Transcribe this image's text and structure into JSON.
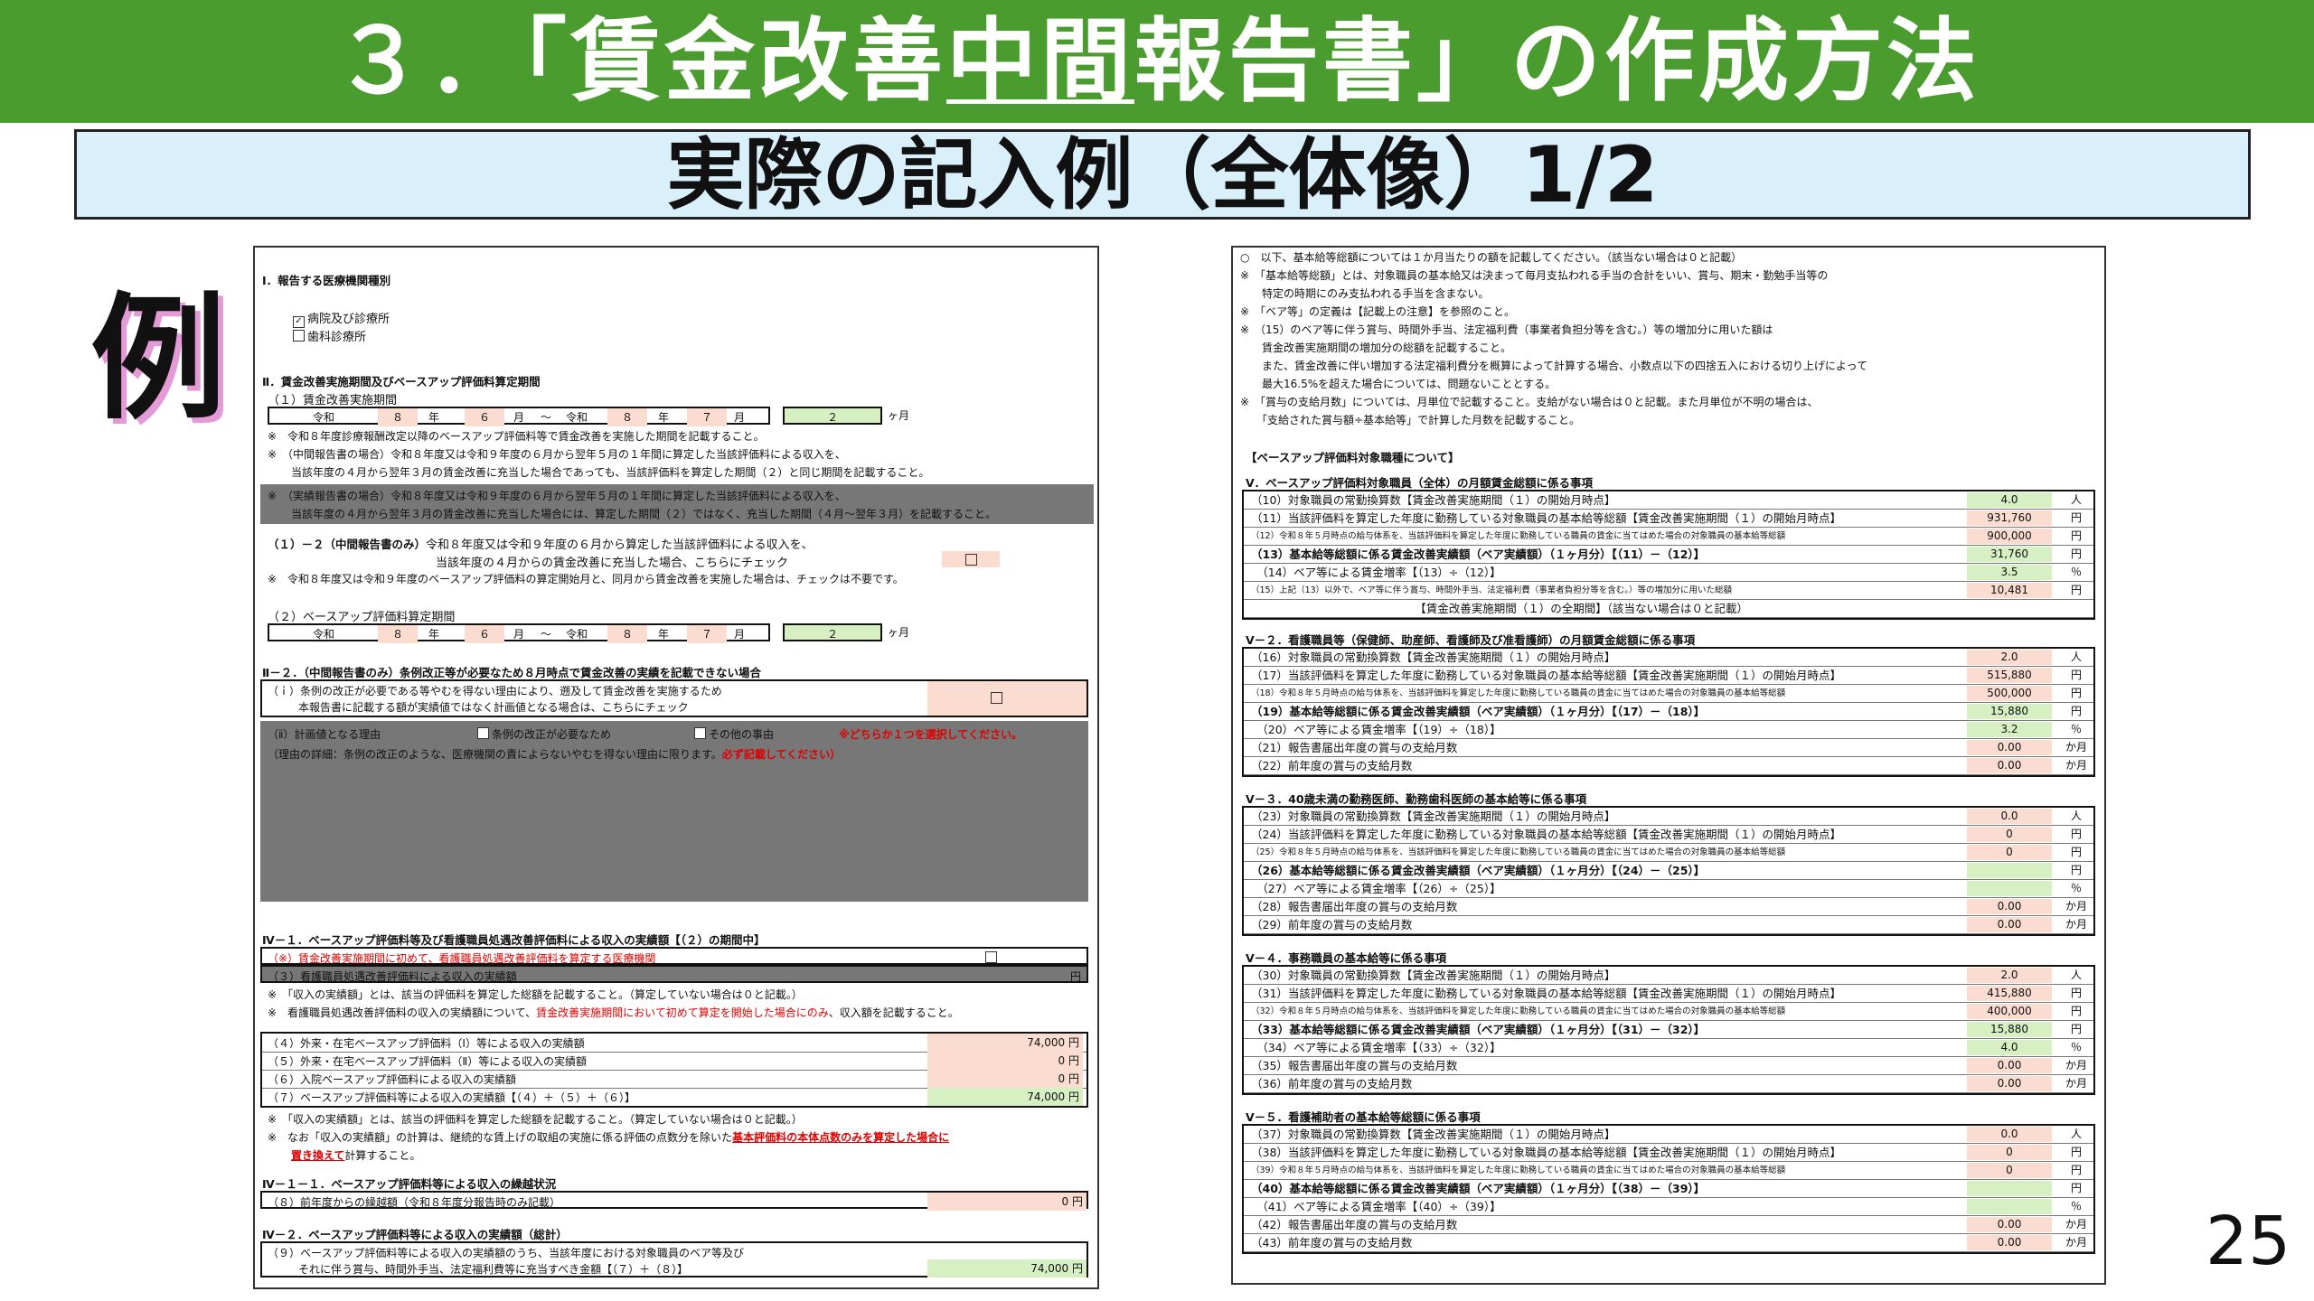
{
  "title": "３．「賃金改善中間報告書」の作成方法",
  "title_parts": [
    "３．「賃金改善",
    "中間",
    "報告書」の作成方法"
  ],
  "subtitle": "実際の記入例（全体像）1/2",
  "example_label": "例",
  "page_number": "25",
  "left": {
    "sec1_heading": "Ⅰ．報告する医療機関種別",
    "sec1_opt1": "病院及び診療所",
    "sec1_opt2": "歯科診療所",
    "sec2_heading": "Ⅱ．賃金改善実施期間及びベースアップ評価料算定期間",
    "sec2_sub1": "（１）賃金改善実施期間",
    "period1": [
      "令和",
      "８",
      "年",
      "６",
      "月",
      "～",
      "令和",
      "８",
      "年",
      "７",
      "月",
      "２",
      "ヶ月"
    ],
    "note_a": "※　令和８年度診療報酬改定以降のベースアップ評価料等で賃金改善を実施した期間を記載すること。",
    "note_b": "※　（中間報告書の場合）令和８年度又は令和９年度の６月から翌年５月の１年間に算定した当該評価料による収入を、",
    "note_b2": "当該年度の４月から翌年３月の賃金改善に充当した場合であっても、当該評価料を算定した期間（２）と同じ期間を記載すること。",
    "note_gray1": "※　（実績報告書の場合）令和８年度又は令和９年度の６月から翌年５月の１年間に算定した当該評価料による収入を、",
    "note_gray2": "当該年度の４月から翌年３月の賃金改善に充当した場合には、算定した期間（２）ではなく、充当した期間（４月～翌年３月）を記載すること。",
    "s12_label": "（１）－２（中間報告書のみ）",
    "s12_text": "令和８年度又は令和９年度の６月から算定した当該評価料による収入を、",
    "s12_text2": "当該年度の４月からの賃金改善に充当した場合、こちらにチェック",
    "s12_note": "※　令和８年度又は令和９年度のベースアップ評価料の算定開始月と、同月から賃金改善を実施した場合は、チェックは不要です。",
    "sec2_sub2": "（２）ベースアップ評価料算定期間",
    "period2": [
      "令和",
      "８",
      "年",
      "６",
      "月",
      "～",
      "令和",
      "８",
      "年",
      "７",
      "月",
      "２",
      "ヶ月"
    ],
    "sec22_heading": "Ⅱ－２．（中間報告書のみ）条例改正等が必要なため８月時点で賃金改善の実績を記載できない場合",
    "sec22_i1": "（ｉ）条例の改正が必要である等やむを得ない理由により、遡及して賃金改善を実施するため",
    "sec22_i2": "本報告書に記載する額が実績値ではなく計画値となる場合は、こちらにチェック",
    "sec22_ii": "（ⅱ）計画値となる理由",
    "sec22_opt1": "条例の改正が必要なため",
    "sec22_opt2": "その他の事由",
    "sec22_red1": "※どちらか１つを選択してください。",
    "sec22_detail": "（理由の詳細：条例の改正のような、医療機関の責によらないやむを得ない理由に限ります。",
    "sec22_red2": "必ず記載してください）",
    "sec41_heading": "Ⅳ－１．ベースアップ評価料等及び看護職員処遇改善評価料による収入の実績額【（２）の期間中】",
    "r_row1": "（※）賃金改善実施期間に初めて、看護職員処遇改善評価料を算定する医療機関",
    "r_row2": "（３）看護職員処遇改善評価料による収入の実績額",
    "r_row2_unit": "円",
    "note_c": "※　「収入の実績額」とは、該当の評価料を算定した総額を記載すること。（算定していない場合は０と記載。）",
    "note_d": "※　看護職員処遇改善評価料の収入の実績額について、",
    "note_d_red": "賃金改善実施期間において初めて算定を開始した場合にのみ",
    "note_d2": "、収入額を記載すること。",
    "rows": [
      {
        "label": "（４）外来・在宅ベースアップ評価料（Ⅰ）等による収入の実績額",
        "value": "74,000 円"
      },
      {
        "label": "（５）外来・在宅ベースアップ評価料（Ⅱ）等による収入の実績額",
        "value": "0 円"
      },
      {
        "label": "（６）入院ベースアップ評価料による収入の実績額",
        "value": "0 円"
      },
      {
        "label": "（７）ベースアップ評価料等による収入の実績額【（４）＋（５）＋（６）】",
        "value": "74,000 円"
      }
    ],
    "note_e": "※　「収入の実績額」とは、該当の評価料を算定した総額を記載すること。（算定していない場合は０と記載。）",
    "note_f": "※　なお「収入の実績額」の計算は、継続的な賃上げの取組の実施に係る評価の点数分を除いた",
    "note_f_red": "基本評価料の本体点数のみを算定した場合に",
    "note_f2_red": "置き換えて",
    "note_f2": "計算すること。",
    "sec411_heading": "Ⅳ－１－１．ベースアップ評価料等による収入の繰越状況",
    "r8_label": "（８）前年度からの繰越額（令和８年度分報告時のみ記載）",
    "r8_value": "0 円",
    "sec42_heading": "Ⅳ－２．ベースアップ評価料等による収入の実績額（総計）",
    "r9_label1": "（９）ベースアップ評価料等による収入の実績額のうち、当該年度における対象職員のベア等及び",
    "r9_label2": "それに伴う賞与、時間外手当、法定福利費等に充当すべき金額【（７）＋（８）】",
    "r9_value": "74,000 円"
  },
  "right": {
    "intro": [
      "○　以下、基本給等総額については１か月当たりの額を記載してください。（該当ない場合は０と記載）",
      "※　「基本給等総額」とは、対象職員の基本給又は決まって毎月支払われる手当の合計をいい、賞与、期末・勤勉手当等の",
      "　　特定の時期にのみ支払われる手当を含まない。",
      "※　「ベア等」の定義は【記載上の注意】を参照のこと。",
      "※　（15）のベア等に伴う賞与、時間外手当、法定福利費（事業者負担分等を含む。）等の増加分に用いた額は",
      "　　賃金改善実施期間の増加分の総額を記載すること。",
      "　　また、賃金改善に伴い増加する法定福利費分を概算によって計算する場合、小数点以下の四捨五入における切り上げによって",
      "　　最大16.5%を超えた場合については、問題ないこととする。",
      "※　「賞与の支給月数」については、月単位で記載すること。支給がない場合は０と記載。また月単位が不明の場合は、",
      "　　「支給された賞与額÷基本給等」で計算した月数を記載すること。"
    ],
    "bracket_heading": "【ベースアップ評価料対象職種について】",
    "groups": [
      {
        "heading": "Ⅴ．ベースアップ評価料対象職員（全体）の月額賃金総額に係る事項",
        "rows": [
          {
            "label": "（10）対象職員の常勤換算数【賃金改善実施期間（１）の開始月時点】",
            "value": "4.0",
            "unit": "人",
            "cls": "greenc"
          },
          {
            "label": "（11）当該評価料を算定した年度に勤務している対象職員の基本給等総額【賃金改善実施期間（１）の開始月時点】",
            "value": "931,760",
            "unit": "円",
            "cls": "pinkc"
          },
          {
            "label": "（12）令和８年５月時点の給与体系を、当該評価料を算定した年度に勤務している職員の賃金に当てはめた場合の対象職員の基本給等総額",
            "value": "900,000",
            "unit": "円",
            "cls": "pinkc",
            "small": true
          },
          {
            "label": "（13）基本給等総額に係る賃金改善実績額（ベア実績額）（１ヶ月分）【（11）－（12）】",
            "value": "31,760",
            "unit": "円",
            "cls": "greenc",
            "bold": true
          },
          {
            "label": "　（14）ベア等による賃金増率【（13）÷（12）】",
            "value": "3.5",
            "unit": "％",
            "cls": "greenc"
          },
          {
            "label": "（15）上記（13）以外で、ベア等に伴う賞与、時間外手当、法定福利費（事業者負担分等を含む。）等の増加分に用いた総額",
            "value": "10,481",
            "unit": "円",
            "cls": "pinkc",
            "small": true
          },
          {
            "label": "　　　　　　　　　　　　　　　【賃金改善実施期間（１）の全期間】（該当ない場合は０と記載）",
            "value": "",
            "unit": "",
            "cls": ""
          }
        ]
      },
      {
        "heading": "Ⅴ－２．看護職員等（保健師、助産師、看護師及び准看護師）の月額賃金総額に係る事項",
        "rows": [
          {
            "label": "（16）対象職員の常勤換算数【賃金改善実施期間（１）の開始月時点】",
            "value": "2.0",
            "unit": "人",
            "cls": "pinkc"
          },
          {
            "label": "（17）当該評価料を算定した年度に勤務している対象職員の基本給等総額【賃金改善実施期間（１）の開始月時点】",
            "value": "515,880",
            "unit": "円",
            "cls": "pinkc"
          },
          {
            "label": "（18）令和８年５月時点の給与体系を、当該評価料を算定した年度に勤務している職員の賃金に当てはめた場合の対象職員の基本給等総額",
            "value": "500,000",
            "unit": "円",
            "cls": "pinkc",
            "small": true
          },
          {
            "label": "（19）基本給等総額に係る賃金改善実績額（ベア実績額）（１ヶ月分）【（17）－（18）】",
            "value": "15,880",
            "unit": "円",
            "cls": "greenc",
            "bold": true
          },
          {
            "label": "　（20）ベア等による賃金増率【（19）÷（18）】",
            "value": "3.2",
            "unit": "％",
            "cls": "greenc"
          },
          {
            "label": "（21）報告書届出年度の賞与の支給月数",
            "value": "0.00",
            "unit": "か月",
            "cls": "pinkc"
          },
          {
            "label": "（22）前年度の賞与の支給月数",
            "value": "0.00",
            "unit": "か月",
            "cls": "pinkc"
          }
        ]
      },
      {
        "heading": "Ⅴ－３．40歳未満の勤務医師、勤務歯科医師の基本給等に係る事項",
        "rows": [
          {
            "label": "（23）対象職員の常勤換算数【賃金改善実施期間（１）の開始月時点】",
            "value": "0.0",
            "unit": "人",
            "cls": "pinkc"
          },
          {
            "label": "（24）当該評価料を算定した年度に勤務している対象職員の基本給等総額【賃金改善実施期間（１）の開始月時点】",
            "value": "0",
            "unit": "円",
            "cls": "pinkc"
          },
          {
            "label": "（25）令和８年５月時点の給与体系を、当該評価料を算定した年度に勤務している職員の賃金に当てはめた場合の対象職員の基本給等総額",
            "value": "0",
            "unit": "円",
            "cls": "pinkc",
            "small": true
          },
          {
            "label": "（26）基本給等総額に係る賃金改善実績額（ベア実績額）（１ヶ月分）【（24）－（25）】",
            "value": "",
            "unit": "円",
            "cls": "greenc",
            "bold": true
          },
          {
            "label": "　（27）ベア等による賃金増率【（26）÷（25）】",
            "value": "",
            "unit": "％",
            "cls": "greenc"
          },
          {
            "label": "（28）報告書届出年度の賞与の支給月数",
            "value": "0.00",
            "unit": "か月",
            "cls": "pinkc"
          },
          {
            "label": "（29）前年度の賞与の支給月数",
            "value": "0.00",
            "unit": "か月",
            "cls": "pinkc"
          }
        ]
      },
      {
        "heading": "Ⅴ－４．事務職員の基本給等に係る事項",
        "rows": [
          {
            "label": "（30）対象職員の常勤換算数【賃金改善実施期間（１）の開始月時点】",
            "value": "2.0",
            "unit": "人",
            "cls": "pinkc"
          },
          {
            "label": "（31）当該評価料を算定した年度に勤務している対象職員の基本給等総額【賃金改善実施期間（１）の開始月時点】",
            "value": "415,880",
            "unit": "円",
            "cls": "pinkc"
          },
          {
            "label": "（32）令和８年５月時点の給与体系を、当該評価料を算定した年度に勤務している職員の賃金に当てはめた場合の対象職員の基本給等総額",
            "value": "400,000",
            "unit": "円",
            "cls": "pinkc",
            "small": true
          },
          {
            "label": "（33）基本給等総額に係る賃金改善実績額（ベア実績額）（１ヶ月分）【（31）－（32）】",
            "value": "15,880",
            "unit": "円",
            "cls": "greenc",
            "bold": true
          },
          {
            "label": "　（34）ベア等による賃金増率【（33）÷（32）】",
            "value": "4.0",
            "unit": "％",
            "cls": "greenc"
          },
          {
            "label": "（35）報告書届出年度の賞与の支給月数",
            "value": "0.00",
            "unit": "か月",
            "cls": "pinkc"
          },
          {
            "label": "（36）前年度の賞与の支給月数",
            "value": "0.00",
            "unit": "か月",
            "cls": "pinkc"
          }
        ]
      },
      {
        "heading": "Ⅴ－５．看護補助者の基本給等総額に係る事項",
        "rows": [
          {
            "label": "（37）対象職員の常勤換算数【賃金改善実施期間（１）の開始月時点】",
            "value": "0.0",
            "unit": "人",
            "cls": "pinkc"
          },
          {
            "label": "（38）当該評価料を算定した年度に勤務している対象職員の基本給等総額【賃金改善実施期間（１）の開始月時点】",
            "value": "0",
            "unit": "円",
            "cls": "pinkc"
          },
          {
            "label": "（39）令和８年５月時点の給与体系を、当該評価料を算定した年度に勤務している職員の賃金に当てはめた場合の対象職員の基本給等総額",
            "value": "0",
            "unit": "円",
            "cls": "pinkc",
            "small": true
          },
          {
            "label": "（40）基本給等総額に係る賃金改善実績額（ベア実績額）（１ヶ月分）【（38）－（39）】",
            "value": "",
            "unit": "円",
            "cls": "greenc",
            "bold": true
          },
          {
            "label": "　（41）ベア等による賃金増率【（40）÷（39）】",
            "value": "",
            "unit": "％",
            "cls": "greenc"
          },
          {
            "label": "（42）報告書届出年度の賞与の支給月数",
            "value": "0.00",
            "unit": "か月",
            "cls": "pinkc"
          },
          {
            "label": "（43）前年度の賞与の支給月数",
            "value": "0.00",
            "unit": "か月",
            "cls": "pinkc"
          }
        ]
      }
    ]
  }
}
